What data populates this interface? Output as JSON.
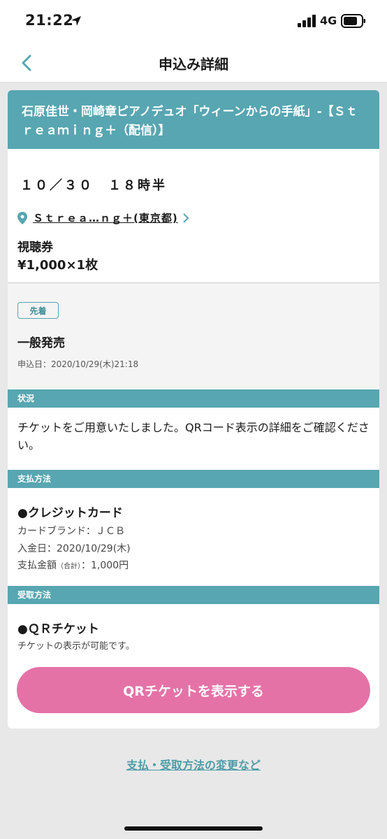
{
  "status_bar": {
    "time": "21:22",
    "network": "4G"
  },
  "nav": {
    "title": "申込み詳細"
  },
  "event": {
    "title": "石原佳世・岡崎章ピアノデュオ「ウィーンからの手紙」-【Ｓｔｒｅａｍｉｎｇ＋（配信）】",
    "date": "１０／３０　１８時半",
    "venue": "Ｓｔｒｅａ…ｎｇ＋(東京都)",
    "ticket_type": "視聴券",
    "ticket_price": "¥1,000×1枚"
  },
  "sale": {
    "badge": "先着",
    "name": "一般発売",
    "apply_date": "申込日：2020/10/29(木)21:18"
  },
  "sections": {
    "status_label": "状況",
    "payment_label": "支払方法",
    "receive_label": "受取方法"
  },
  "status": {
    "text": "チケットをご用意いたしました。QRコード表示の詳細をご確認ください。"
  },
  "payment": {
    "method": "●クレジットカード",
    "brand": "カードブランド：ＪＣＢ",
    "paid_date": "入金日：2020/10/29(木)",
    "amount_label": "支払金額",
    "amount_note": "（合計）",
    "amount_value": "：1,000円"
  },
  "receive": {
    "method": "●ＱＲチケット",
    "note": "チケットの表示が可能です。"
  },
  "actions": {
    "qr_button": "QRチケットを表示する",
    "change_link": "支払・受取方法の変更など"
  },
  "colors": {
    "accent": "#57a6b1",
    "button": "#e572a7",
    "background": "#e8e8e8"
  }
}
